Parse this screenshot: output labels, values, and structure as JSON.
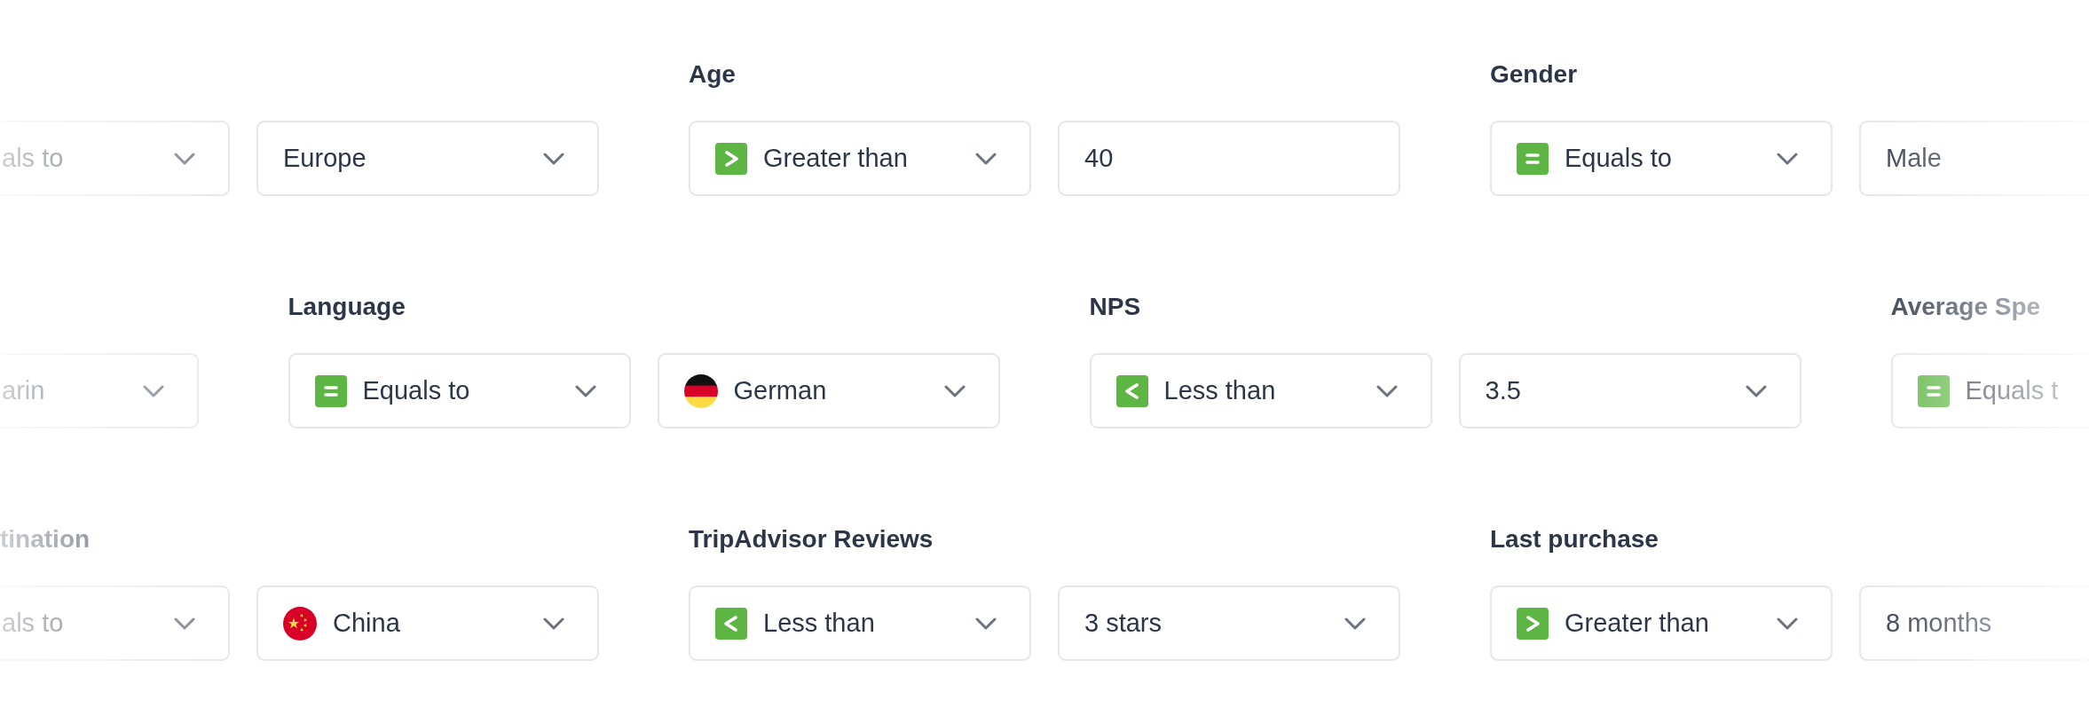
{
  "rows": [
    {
      "groups": [
        {
          "fields": [
            {
              "kind": "select",
              "cut_left": true,
              "cut_right": false,
              "value": "als to"
            },
            {
              "kind": "select",
              "cut_left": false,
              "cut_right": false,
              "value": "Europe"
            }
          ]
        },
        {
          "label": "Age",
          "fields": [
            {
              "kind": "select",
              "cut_left": false,
              "cut_right": false,
              "icon": {
                "kind": "greater"
              },
              "value": "Greater than"
            },
            {
              "kind": "input",
              "cut_left": false,
              "cut_right": false,
              "value": "40"
            }
          ]
        },
        {
          "label": "Gender",
          "fields": [
            {
              "kind": "select",
              "cut_left": false,
              "cut_right": false,
              "icon": {
                "kind": "equals"
              },
              "value": "Equals to"
            },
            {
              "kind": "input",
              "cut_left": false,
              "cut_right": true,
              "value": "Male"
            }
          ]
        }
      ]
    },
    {
      "groups": [
        {
          "fields": [
            {
              "kind": "select",
              "cut_left": true,
              "cut_right": false,
              "value": "arin"
            }
          ]
        },
        {
          "label": "Language",
          "fields": [
            {
              "kind": "select",
              "cut_left": false,
              "cut_right": false,
              "icon": {
                "kind": "equals"
              },
              "value": "Equals to"
            },
            {
              "kind": "select",
              "cut_left": false,
              "cut_right": false,
              "icon": {
                "kind": "germany"
              },
              "value": "German"
            }
          ]
        },
        {
          "label": "NPS",
          "fields": [
            {
              "kind": "select",
              "cut_left": false,
              "cut_right": false,
              "icon": {
                "kind": "less"
              },
              "value": "Less than"
            },
            {
              "kind": "select",
              "cut_left": false,
              "cut_right": false,
              "value": "3.5"
            }
          ]
        },
        {
          "label": "Average Spe",
          "fields": [
            {
              "kind": "select",
              "cut_left": false,
              "cut_right": true,
              "icon": {
                "kind": "equals"
              },
              "value": "Equals t"
            }
          ]
        }
      ]
    },
    {
      "groups": [
        {
          "label": "tination",
          "fields": [
            {
              "kind": "select",
              "cut_left": true,
              "cut_right": false,
              "value": "als to"
            },
            {
              "kind": "select",
              "cut_left": false,
              "cut_right": false,
              "icon": {
                "kind": "china"
              },
              "value": "China"
            }
          ]
        },
        {
          "label": "TripAdvisor Reviews",
          "fields": [
            {
              "kind": "select",
              "cut_left": false,
              "cut_right": false,
              "icon": {
                "kind": "less"
              },
              "value": "Less than"
            },
            {
              "kind": "select",
              "cut_left": false,
              "cut_right": false,
              "value": "3 stars"
            }
          ]
        },
        {
          "label": "Last purchase",
          "fields": [
            {
              "kind": "select",
              "cut_left": false,
              "cut_right": false,
              "icon": {
                "kind": "greater"
              },
              "value": "Greater than"
            },
            {
              "kind": "input",
              "cut_left": false,
              "cut_right": true,
              "value": "8 months"
            }
          ]
        }
      ]
    }
  ]
}
